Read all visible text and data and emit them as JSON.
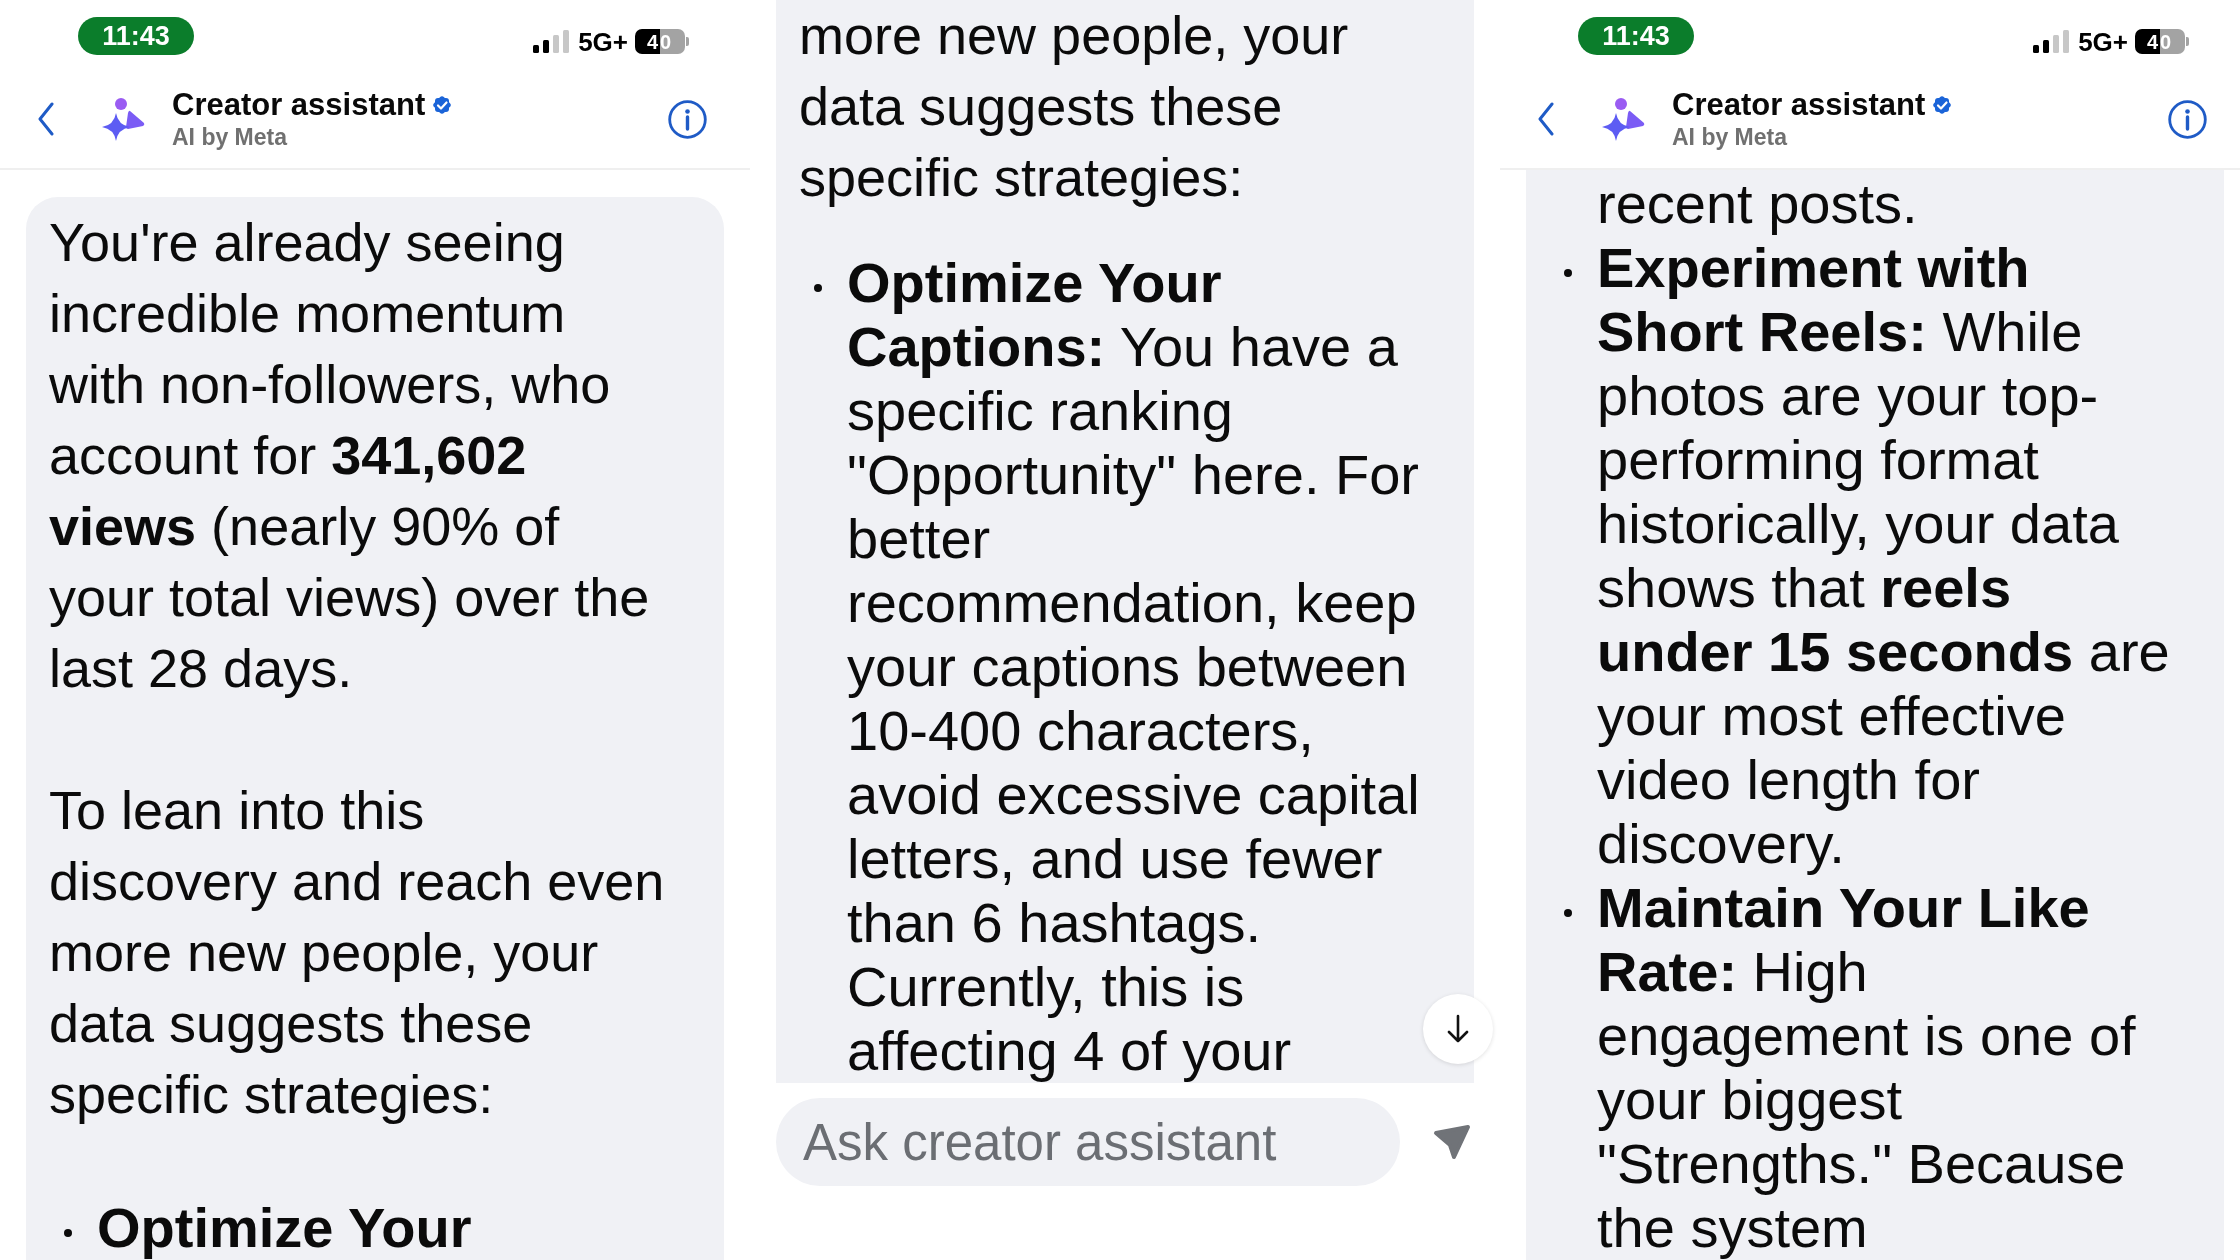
{
  "screens": [
    {
      "status_bar": {
        "time": "11:43",
        "network": "5G+",
        "battery": "40"
      },
      "header": {
        "title": "Creator assistant",
        "verified": true,
        "subtitle": "AI by Meta"
      },
      "message": {
        "blocks": [
          {
            "kind": "paragraph",
            "lines": [
              "You're already seeing",
              "incredible momentum",
              "with non-followers, who",
              "account for **341,602**",
              "**views** (nearly 90% of",
              "your total views) over the",
              "last 28 days."
            ]
          },
          {
            "kind": "paragraph",
            "lines": [
              "To lean into this",
              "discovery and reach even",
              "more new people, your",
              "data suggests these",
              "specific strategies:"
            ]
          },
          {
            "kind": "list_item",
            "bullet": true,
            "lines": [
              "**Optimize Your**"
            ]
          }
        ]
      }
    },
    {
      "message": {
        "blocks": [
          {
            "kind": "paragraph",
            "lines": [
              "more new people, your",
              "data suggests these",
              "specific strategies:"
            ]
          },
          {
            "kind": "list_item",
            "bullet": true,
            "lines": [
              "**Optimize Your**",
              "**Captions:** You have a",
              "specific ranking",
              "\"Opportunity\" here. For",
              "better",
              "recommendation, keep",
              "your captions between",
              "10-400 characters,",
              "avoid excessive capital",
              "letters, and use fewer",
              "than 6 hashtags.",
              "Currently, this is",
              "affecting 4 of your"
            ]
          }
        ]
      },
      "scroll_down_button": true,
      "composer": {
        "placeholder": "Ask creator assistant",
        "send_disabled": true
      }
    },
    {
      "status_bar": {
        "time": "11:43",
        "network": "5G+",
        "battery": "40"
      },
      "header": {
        "title": "Creator assistant",
        "verified": true,
        "subtitle": "AI by Meta"
      },
      "message": {
        "blocks": [
          {
            "kind": "list_item",
            "bullet": false,
            "lines": [
              "recent posts."
            ]
          },
          {
            "kind": "list_item",
            "bullet": true,
            "lines": [
              "**Experiment with**",
              "**Short Reels:** While",
              "photos are your top-",
              "performing format",
              "historically, your data",
              "shows that **reels**",
              "**under 15 seconds** are",
              "your most effective",
              "video length for",
              "discovery."
            ]
          },
          {
            "kind": "list_item",
            "bullet": true,
            "lines": [
              "**Maintain Your Like**",
              "**Rate:** High",
              "engagement is one of",
              "your biggest",
              "\"Strengths.\" Because",
              "the system"
            ]
          }
        ]
      }
    }
  ]
}
